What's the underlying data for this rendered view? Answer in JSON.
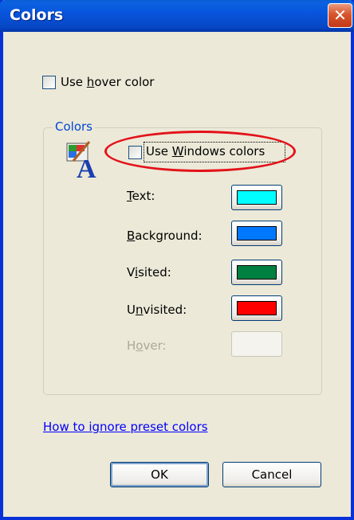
{
  "window": {
    "title": "Colors",
    "close_glyph": "✕"
  },
  "use_hover": {
    "label_pre": "Use ",
    "label_accel": "h",
    "label_post": "over color",
    "checked": false
  },
  "group": {
    "legend": "Colors",
    "icon": "color-settings-icon",
    "use_windows": {
      "label_pre": "Use ",
      "label_accel": "W",
      "label_post": "indows colors",
      "checked": false
    },
    "rows": [
      {
        "accel": "T",
        "rest": "ext:",
        "color": "#00ffff",
        "disabled": false
      },
      {
        "accel": "B",
        "rest": "ackground:",
        "color": "#0078ff",
        "disabled": false
      },
      {
        "pre": "V",
        "accel": "i",
        "rest": "sited:",
        "color": "#008040",
        "disabled": false
      },
      {
        "pre": "U",
        "accel": "n",
        "rest": "visited:",
        "color": "#ff0000",
        "disabled": false
      },
      {
        "pre": "H",
        "accel": "o",
        "rest": "ver:",
        "color": "",
        "disabled": true
      }
    ]
  },
  "link_text": "How to ignore preset colors",
  "buttons": {
    "ok": "OK",
    "cancel": "Cancel"
  },
  "annotation_color": "#e3121a"
}
